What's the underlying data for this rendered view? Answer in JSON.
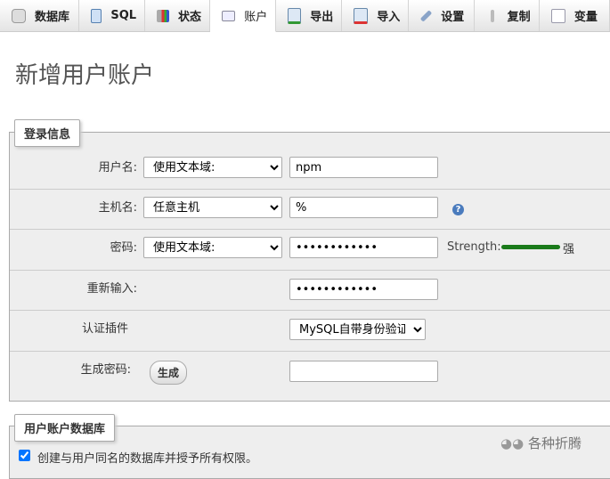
{
  "tabs": [
    {
      "label": "数据库",
      "icon": "database-icon"
    },
    {
      "label": "SQL",
      "icon": "sql-icon"
    },
    {
      "label": "状态",
      "icon": "status-icon"
    },
    {
      "label": "账户",
      "icon": "accounts-icon"
    },
    {
      "label": "导出",
      "icon": "export-icon"
    },
    {
      "label": "导入",
      "icon": "import-icon"
    },
    {
      "label": "设置",
      "icon": "wrench-icon"
    },
    {
      "label": "复制",
      "icon": "replication-icon"
    },
    {
      "label": "变量",
      "icon": "variables-icon"
    }
  ],
  "title": "新增用户账户",
  "login": {
    "legend": "登录信息",
    "username_label": "用户名:",
    "username_select": "使用文本域:",
    "username_value": "npm",
    "host_label": "主机名:",
    "host_select": "任意主机",
    "host_value": "%",
    "password_label": "密码:",
    "password_select": "使用文本域:",
    "password_value": "••••••••••••",
    "strength_label": "Strength:",
    "strength_text": "强",
    "strength_fraction": 1.0,
    "strength_color": "#1a7a1a",
    "retype_label": "重新输入:",
    "retype_value": "••••••••••••",
    "plugin_label": "认证插件",
    "plugin_select": "MySQL自带身份验证",
    "generate_label": "生成密码:",
    "generate_button": "生成"
  },
  "db": {
    "legend": "用户账户数据库",
    "checkbox_label": "创建与用户同名的数据库并授予所有权限。",
    "checked": true
  },
  "watermark": "各种折腾"
}
